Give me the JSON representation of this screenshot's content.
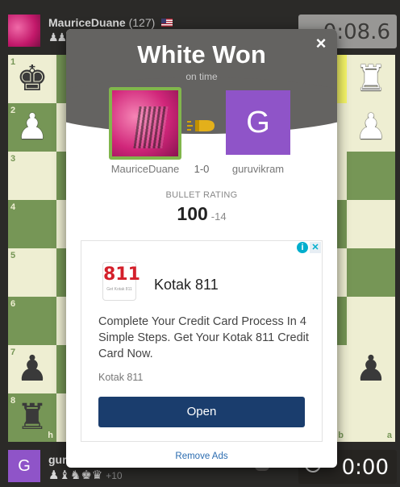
{
  "top_player": {
    "name": "MauriceDuane",
    "rating": "(127)",
    "flag": "us-flag-icon",
    "captured": "♟♟♟♟",
    "clock": "0:08.6"
  },
  "bottom_player": {
    "avatar_letter": "G",
    "name": "gur",
    "captured": "♟♝♞♚♛",
    "advantage": "+10",
    "clock": "0:00"
  },
  "board": {
    "light_color": "#eeeed2",
    "dark_color": "#769656",
    "highlight_color": "#f6f669",
    "ranks": [
      "1",
      "2",
      "3",
      "4",
      "5",
      "6",
      "7",
      "8"
    ],
    "files_visible": [
      "h",
      "b",
      "a"
    ]
  },
  "modal": {
    "title": "White Won",
    "subtitle": "on time",
    "close": "×",
    "winner": {
      "name": "MauriceDuane"
    },
    "score": "1-0",
    "loser": {
      "name": "guruvikram",
      "avatar_letter": "G"
    },
    "rating_label": "BULLET RATING",
    "rating_value": "100",
    "rating_change": "-14",
    "header_color": "#646361",
    "winner_border_color": "#81b64c"
  },
  "ad": {
    "logo_text": "811",
    "logo_caption": "Get Kotak 811",
    "brand": "Kotak 811",
    "text": "Complete Your Credit Card Process In 4 Simple Steps. Get Your Kotak 811 Credit Card Now.",
    "sponsor": "Kotak 811",
    "cta": "Open",
    "info": "i",
    "close": "✕"
  },
  "remove_ads": "Remove Ads"
}
